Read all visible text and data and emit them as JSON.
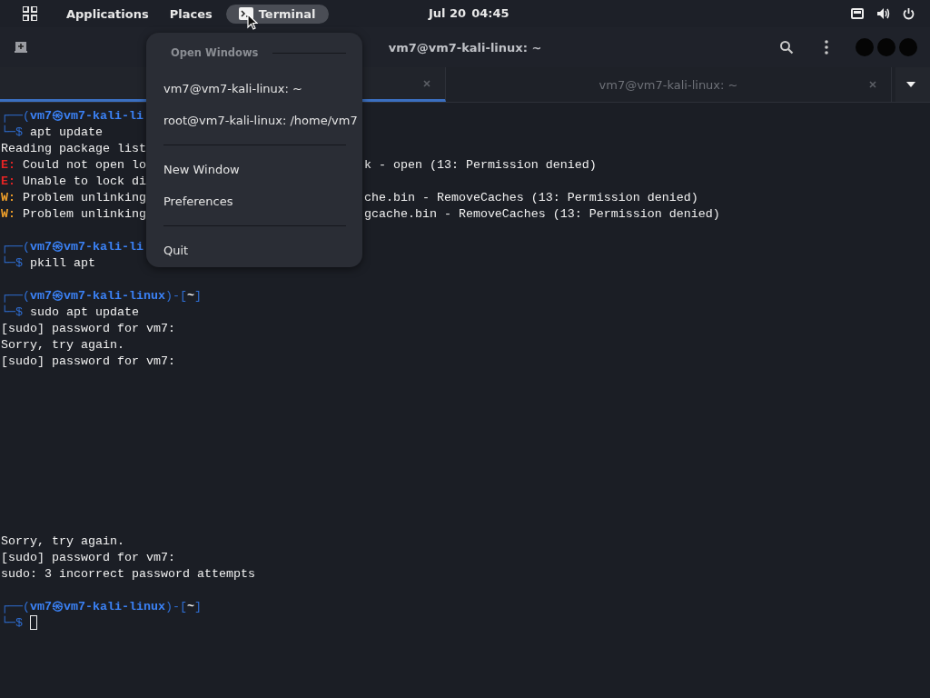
{
  "top_bar": {
    "applications": "Applications",
    "places": "Places",
    "app_menu": {
      "label": "Terminal",
      "selected": true
    },
    "clock_date": "Jul 20",
    "clock_time": "04:45"
  },
  "window": {
    "title": "vm7@vm7-kali-linux: ~"
  },
  "tabs": [
    {
      "selected": true
    },
    {
      "label": "vm7@vm7-kali-linux: ~",
      "selected": false
    }
  ],
  "terminal_lines": [
    {
      "kind": "prompt",
      "parts": [
        "┌──(",
        "vm7㉿vm7-kali-li"
      ]
    },
    {
      "kind": "command",
      "prompt": "└─$",
      "text": "apt update"
    },
    {
      "kind": "output",
      "text": "Reading package list"
    },
    {
      "kind": "error",
      "prefix": "E:",
      "text": "Could not open lo",
      "right": "k - open (13: Permission denied)"
    },
    {
      "kind": "error",
      "prefix": "E:",
      "text": "Unable to lock di"
    },
    {
      "kind": "warning",
      "prefix": "W:",
      "text": "Problem unlinking",
      "right": "che.bin - RemoveCaches (13: Permission denied)"
    },
    {
      "kind": "warning",
      "prefix": "W:",
      "text": "Problem unlinking",
      "right": "gcache.bin - RemoveCaches (13: Permission denied)"
    },
    {
      "kind": "blank"
    },
    {
      "kind": "prompt",
      "parts": [
        "┌──(",
        "vm7㉿vm7-kali-li"
      ]
    },
    {
      "kind": "command",
      "prompt": "└─$",
      "text": "pkill apt"
    },
    {
      "kind": "blank"
    },
    {
      "kind": "prompt",
      "parts": [
        "┌──(",
        "vm7㉿vm7-kali-linux",
        ")-[",
        "~",
        "]"
      ]
    },
    {
      "kind": "command",
      "prompt": "└─$",
      "text": "sudo apt update"
    },
    {
      "kind": "output",
      "text": "[sudo] password for vm7:"
    },
    {
      "kind": "output",
      "text": "Sorry, try again."
    },
    {
      "kind": "output",
      "text": "[sudo] password for vm7:"
    },
    {
      "kind": "blank"
    },
    {
      "kind": "blank"
    },
    {
      "kind": "blank"
    },
    {
      "kind": "blank"
    },
    {
      "kind": "blank"
    },
    {
      "kind": "blank"
    },
    {
      "kind": "blank"
    },
    {
      "kind": "blank"
    },
    {
      "kind": "blank"
    },
    {
      "kind": "blank"
    },
    {
      "kind": "output",
      "text": "Sorry, try again."
    },
    {
      "kind": "output",
      "text": "[sudo] password for vm7:"
    },
    {
      "kind": "output",
      "text": "sudo: 3 incorrect password attempts"
    },
    {
      "kind": "blank"
    },
    {
      "kind": "prompt",
      "parts": [
        "┌──(",
        "vm7㉿vm7-kali-linux",
        ")-[",
        "~",
        "]"
      ]
    },
    {
      "kind": "input",
      "prompt": "└─$"
    }
  ],
  "menu": {
    "section_title": "Open Windows",
    "groups": [
      [
        "vm7@vm7-kali-linux: ~",
        "root@vm7-kali-linux: /home/vm7"
      ],
      [
        "New Window",
        "Preferences"
      ],
      [
        "Quit"
      ]
    ]
  }
}
